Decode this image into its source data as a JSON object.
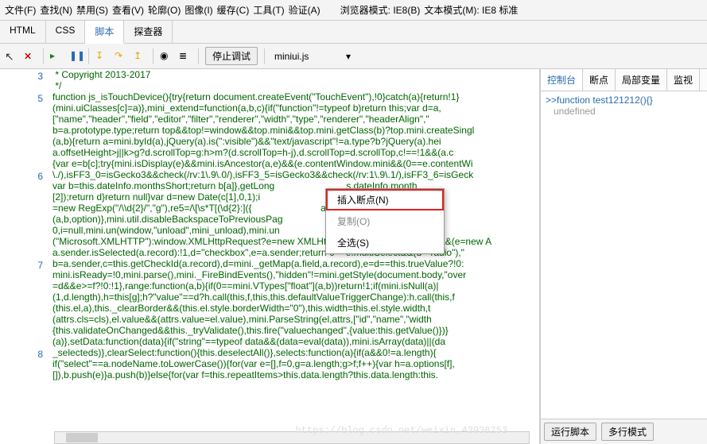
{
  "menubar": {
    "items": [
      "文件(F)",
      "查找(N)",
      "禁用(S)",
      "查看(V)",
      "轮廓(O)",
      "图像(I)",
      "缓存(C)",
      "工具(T)",
      "验证(A)"
    ],
    "mode_label_1": "浏览器模式: IE8(B)",
    "mode_label_2": "文本模式(M): IE8 标准"
  },
  "tabs": {
    "items": [
      "HTML",
      "CSS",
      "脚本",
      "探查器"
    ],
    "active": 2
  },
  "toolbar": {
    "stop_debug": "停止调试",
    "filename": "miniui.js"
  },
  "gutter": {
    "lines": [
      "3",
      "",
      "5",
      "",
      "",
      "",
      "",
      "",
      "",
      "6",
      "",
      "",
      "",
      "",
      "",
      "",
      "",
      "7",
      "",
      "",
      "",
      "",
      "",
      "",
      "",
      "8",
      "",
      ""
    ]
  },
  "code_lines": [
    " * Copyright 2013-2017",
    " */",
    "function js_isTouchDevice(){try{return document.createEvent(\"TouchEvent\"),!0}catch(a){return!1}",
    "(mini.uiClasses[c]=a)},mini_extend=function(a,b,c){if(\"function\"!=typeof b)return this;var d=a,",
    "[\"name\",\"header\",\"field\",\"editor\",\"filter\",\"renderer\",\"width\",\"type\",\"renderer\",\"headerAlign\",\"",
    "b=a.prototype.type;return top&&top!=window&&top.mini&&top.mini.getClass(b)?top.mini.createSingl",
    "(a,b){return a=mini.byId(a),jQuery(a).is(\":visible\")&&\"text/javascript\"!=a.type?b?jQuery(a).hei",
    "a.offsetHeight>j||k>g?d.scrollTop=g:h>m?(d.scrollTop=h-j),d.scrollTop=d.scrollTop,c!==!1&&(a.c",
    "{var e=b[c];try{mini.isDisplay(e)&&mini.isAncestor(a,e)&&(e.contentWindow.mini&&(0==e.contentWi",
    "\\./),isFF3_0=isGecko3&&check(/rv:1\\.9\\.0/),isFF3_5=isGecko3&&check(/rv:1\\.9\\.1/),isFF3_6=isGeck",
    "var b=this.dateInfo.monthsShort;return b[a]},getLong                           s.dateInfo.month",
    "[2]);return d}return null}var d=new Date(c[1],0,1);i                           (c[1],0,1,9,0);c",
    "=new RegExp(\"/\\\\d{2}/\",\"g\"),re5=/\\[\\s*T[(\\d{2}:]({                          ad(2,i,\"0\")+\"\"",
    "(a,b,option)},mini.util.disableBackspaceToPreviousPag                          nbind(\"keydown\")",
    "0,i=null,mini.un(window,\"unload\",mini_unload),mini.un                         ),mini.un(window",
    "(\"Microsoft.XMLHTTP\"):window.XMLHttpRequest?e=new XMLHttpRequest:window.ActiveX&&(e=new A",
    "a.sender.isSelected(a.record):!1,d=\"checkbox\",e=a.sender;return 0==e.multiSelect&&(d=\"radio\"),\"",
    "b=a.sender,c=this.getCheckId(a.record),d=mini._getMap(a.field,a.record),e=d==this.trueValue?!0:",
    "mini.isReady=!0,mini.parse(),mini._FireBindEvents(),\"hidden\"!=mini.getStyle(document.body,\"over",
    "=d&&e>=f?!0:!1},range:function(a,b){if(0==mini.VTypes[\"float\"](a,b))return!1;if(mini.isNull(a)|",
    "(1,d.length),h=this[g];h?\"value\"==d?h.call(this,f,this,this.defaultValueTriggerChange):h.call(this,f",
    "(this.el,a),this._clearBorder&&(this.el.style.borderWidth=\"0\"),this.width=this.el.style.width,t",
    "(attrs.cls=cls),el.value&&(attrs.value=el.value),mini.ParseString(el,attrs,[\"id\",\"name\",\"width",
    "{this.validateOnChanged&&this._tryValidate(),this.fire(\"valuechanged\",{value:this.getValue()})}",
    "(a)},setData:function(data){if(\"string\"==typeof data&&(data=eval(data)),mini.isArray(data)||(da",
    "_selecteds)},clearSelect:function(){this.deselectAll()},selects:function(a){if(a&&0!=a.length){",
    "if(\"select\"==a.nodeName.toLowerCase()){for(var e=[],f=0,g=a.length;g>f;f++){var h=a.options[f],",
    "[]),b.push(e)}a.push(b)}else{for(var f=this.repeatItems>this.data.length?this.data.length:this."
  ],
  "context_menu": {
    "items": [
      {
        "label": "插入断点(N)",
        "highlight": true,
        "disabled": false
      },
      {
        "label": "复制(O)",
        "highlight": false,
        "disabled": true
      },
      {
        "label": "全选(S)",
        "highlight": false,
        "disabled": false
      }
    ]
  },
  "right_panel": {
    "tabs": [
      "控制台",
      "断点",
      "局部变量",
      "监视"
    ],
    "active": 0,
    "console_input": ">>function test121212(){}",
    "console_output": "undefined",
    "run_script": "运行脚本",
    "multiline": "多行模式"
  },
  "watermark": "https://blog.csdn.net/weixin_43938253"
}
